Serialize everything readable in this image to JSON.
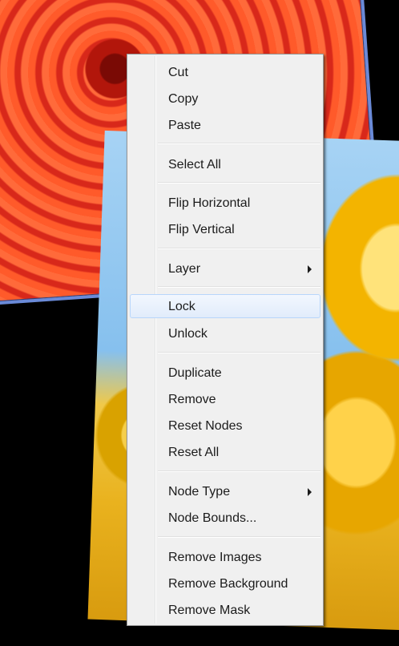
{
  "menu": {
    "items": [
      {
        "label": "Cut"
      },
      {
        "label": "Copy"
      },
      {
        "label": "Paste"
      },
      {
        "label": "Select All"
      },
      {
        "label": "Flip Horizontal"
      },
      {
        "label": "Flip Vertical"
      },
      {
        "label": "Layer",
        "submenu": true
      },
      {
        "label": "Lock",
        "highlighted": true
      },
      {
        "label": "Unlock"
      },
      {
        "label": "Duplicate"
      },
      {
        "label": "Remove"
      },
      {
        "label": "Reset Nodes"
      },
      {
        "label": "Reset All"
      },
      {
        "label": "Node Type",
        "submenu": true
      },
      {
        "label": "Node Bounds..."
      },
      {
        "label": "Remove Images"
      },
      {
        "label": "Remove Background"
      },
      {
        "label": "Remove Mask"
      }
    ]
  },
  "colors": {
    "menu_background": "#f0f0f0",
    "menu_border": "#979797",
    "highlight_border": "#b8d6fb",
    "canvas_background": "#000000"
  }
}
